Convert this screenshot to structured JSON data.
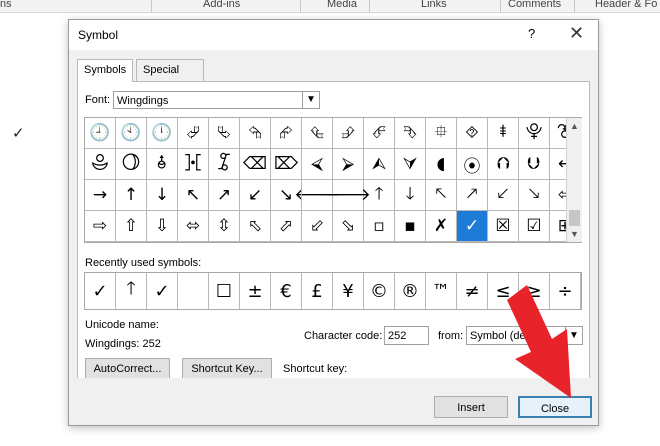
{
  "ribbon": {
    "tabs": [
      "ns",
      "Add-ins",
      "Media",
      "Links",
      "Comments",
      "Header & Fo"
    ]
  },
  "document": {
    "check_mark": "✓"
  },
  "dialog": {
    "title": "Symbol",
    "help": "?",
    "close_glyph": "✕",
    "tabs": [
      "Symbols",
      "Special Characters"
    ],
    "font_label": "Font:",
    "font_value": "Wingdings",
    "symbols": [
      [
        "🕘",
        "🕙",
        "🕛",
        "⮰",
        "⮱",
        "⮲",
        "⮳",
        "⮴",
        "⮵",
        "⮶",
        "⮷",
        "⯐",
        "⯑",
        "⯒",
        "⯓",
        "⯔"
      ],
      [
        "⯕",
        "⯖",
        "⯗",
        "⯘",
        "⯙",
        "⌫",
        "⌦",
        "⮘",
        "⮚",
        "⮙",
        "⮛",
        "◖",
        "⦿",
        "⮉",
        "⮋",
        "←"
      ],
      [
        "→",
        "↑",
        "↓",
        "↖",
        "↗",
        "↙",
        "↘",
        "🡐",
        "🡒",
        "🡑",
        "🡓",
        "🡔",
        "🡕",
        "🡗",
        "🡖",
        "⇦"
      ],
      [
        "⇨",
        "⇧",
        "⇩",
        "⬄",
        "⇳",
        "⬁",
        "⬀",
        "⬃",
        "⬂",
        "▫",
        "▪",
        "✗",
        "✓",
        "☒",
        "☑",
        "⊞"
      ]
    ],
    "selected_symbol": "✓",
    "recent_label": "Recently used symbols:",
    "recent": [
      "✓",
      "🡑",
      "✓",
      "",
      "☐",
      "±",
      "€",
      "£",
      "¥",
      "©",
      "®",
      "™",
      "≠",
      "≤",
      "≥",
      "÷"
    ],
    "unicode_name_label": "Unicode name:",
    "unicode_name_value": "Wingdings: 252",
    "char_code_label": "Character code:",
    "char_code_value": "252",
    "from_label": "from:",
    "from_value": "Symbol (de",
    "autocorrect_label": "AutoCorrect...",
    "shortcut_key_button": "Shortcut Key...",
    "shortcut_key_label": "Shortcut key:",
    "insert_label": "Insert",
    "close_label": "Close"
  },
  "colors": {
    "selection": "#1e7bd7",
    "annotation_arrow": "#e8232a"
  }
}
